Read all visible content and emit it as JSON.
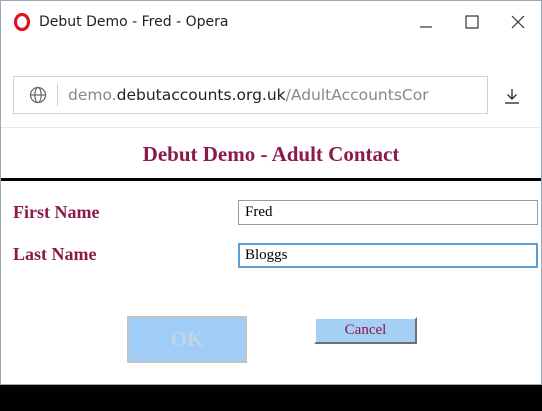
{
  "window": {
    "title": "Debut Demo - Fred - Opera"
  },
  "address": {
    "url_prefix": "demo.",
    "url_domain": "debutaccounts.org.uk",
    "url_path": "/AdultAccountsCor"
  },
  "page": {
    "title": "Debut Demo - Adult Contact"
  },
  "form": {
    "first_name_label": "First Name",
    "first_name_value": "Fred",
    "last_name_label": "Last Name",
    "last_name_value": "Bloggs",
    "ok_label": "OK",
    "cancel_label": "Cancel"
  },
  "colors": {
    "label": "#8b1a4a",
    "button_bg": "#a6cff5",
    "focus_border": "#5e9ed6"
  }
}
